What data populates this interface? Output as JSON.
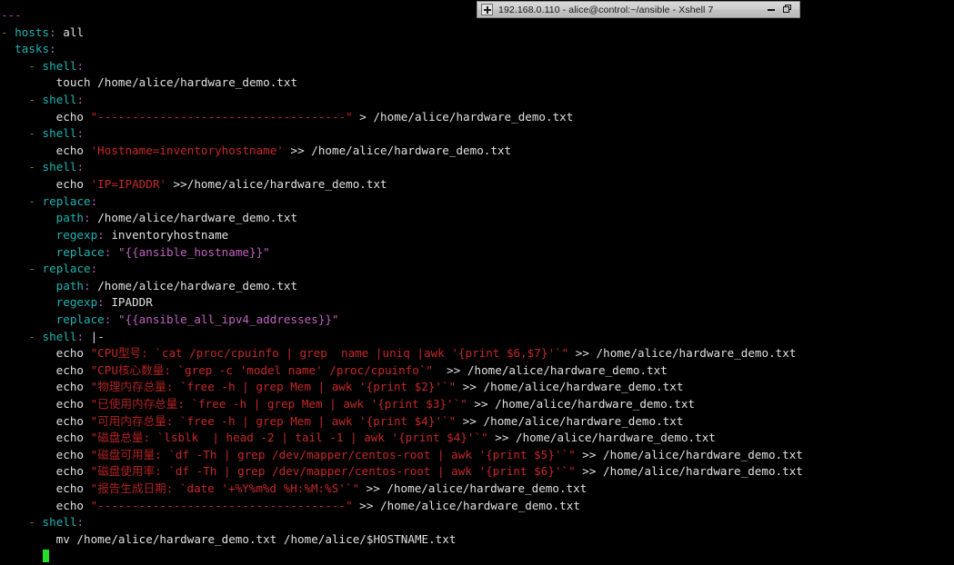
{
  "window": {
    "title": "192.168.0.110 - alice@control:~/ansible - Xshell 7",
    "icon": "xshell-session-icon",
    "minimize_label": "minimize",
    "restore_label": "restore",
    "background_color": "#000000",
    "titlebar_color": "#c8c8c8"
  },
  "terminal": {
    "prompt_cursor": "block-cursor",
    "cursor_color": "#24e024",
    "foreground": "#d8d8d8",
    "file_type": "ansible-yaml-playbook",
    "separator": "------------------------------------",
    "lines": [
      {
        "id": 0,
        "text": "---"
      },
      {
        "id": 1,
        "text": "- hosts: all"
      },
      {
        "id": 2,
        "text": "  tasks:"
      },
      {
        "id": 3,
        "text": "    - shell:"
      },
      {
        "id": 4,
        "text": "        touch /home/alice/hardware_demo.txt"
      },
      {
        "id": 5,
        "text": "    - shell:"
      },
      {
        "id": 6,
        "text": "        echo \"------------------------------------\" > /home/alice/hardware_demo.txt"
      },
      {
        "id": 7,
        "text": "    - shell:"
      },
      {
        "id": 8,
        "text": "        echo 'Hostname=inventoryhostname' >> /home/alice/hardware_demo.txt"
      },
      {
        "id": 9,
        "text": "    - shell:"
      },
      {
        "id": 10,
        "text": "        echo 'IP=IPADDR' >>/home/alice/hardware_demo.txt"
      },
      {
        "id": 11,
        "text": "    - replace:"
      },
      {
        "id": 12,
        "text": "        path: /home/alice/hardware_demo.txt"
      },
      {
        "id": 13,
        "text": "        regexp: inventoryhostname"
      },
      {
        "id": 14,
        "text": "        replace: \"{{ansible_hostname}}\""
      },
      {
        "id": 15,
        "text": "    - replace:"
      },
      {
        "id": 16,
        "text": "        path: /home/alice/hardware_demo.txt"
      },
      {
        "id": 17,
        "text": "        regexp: IPADDR"
      },
      {
        "id": 18,
        "text": "        replace: \"{{ansible_all_ipv4_addresses}}\""
      },
      {
        "id": 19,
        "text": "    - shell: |-"
      },
      {
        "id": 20,
        "text": "        echo \"CPU型号: `cat /proc/cpuinfo | grep  name |uniq |awk '{print $6,$7}'`\" >> /home/alice/hardware_demo.txt"
      },
      {
        "id": 21,
        "text": "        echo \"CPU核心数量: `grep -c 'model name' /proc/cpuinfo`\"  >> /home/alice/hardware_demo.txt"
      },
      {
        "id": 22,
        "text": "        echo \"物理内存总量: `free -h | grep Mem | awk '{print $2}'`\" >> /home/alice/hardware_demo.txt"
      },
      {
        "id": 23,
        "text": "        echo \"已使用内存总量: `free -h | grep Mem | awk '{print $3}'`\" >> /home/alice/hardware_demo.txt"
      },
      {
        "id": 24,
        "text": "        echo \"可用内存总量: `free -h | grep Mem | awk '{print $4}'`\" >> /home/alice/hardware_demo.txt"
      },
      {
        "id": 25,
        "text": "        echo \"磁盘总量: `lsblk  | head -2 | tail -1 | awk '{print $4}'`\" >> /home/alice/hardware_demo.txt"
      },
      {
        "id": 26,
        "text": "        echo \"磁盘可用量: `df -Th | grep /dev/mapper/centos-root | awk '{print $5}'`\" >> /home/alice/hardware_demo.txt"
      },
      {
        "id": 27,
        "text": "        echo \"磁盘使用率: `df -Th | grep /dev/mapper/centos-root | awk '{print $6}'`\" >> /home/alice/hardware_demo.txt"
      },
      {
        "id": 28,
        "text": "        echo \"报告生成日期: `date '+%Y%m%d %H:%M:%S'`\" >> /home/alice/hardware_demo.txt"
      },
      {
        "id": 29,
        "text": "        echo \"------------------------------------\" >> /home/alice/hardware_demo.txt"
      },
      {
        "id": 30,
        "text": "    - shell:"
      },
      {
        "id": 31,
        "text": "        mv /home/alice/hardware_demo.txt /home/alice/$HOSTNAME.txt"
      }
    ]
  }
}
